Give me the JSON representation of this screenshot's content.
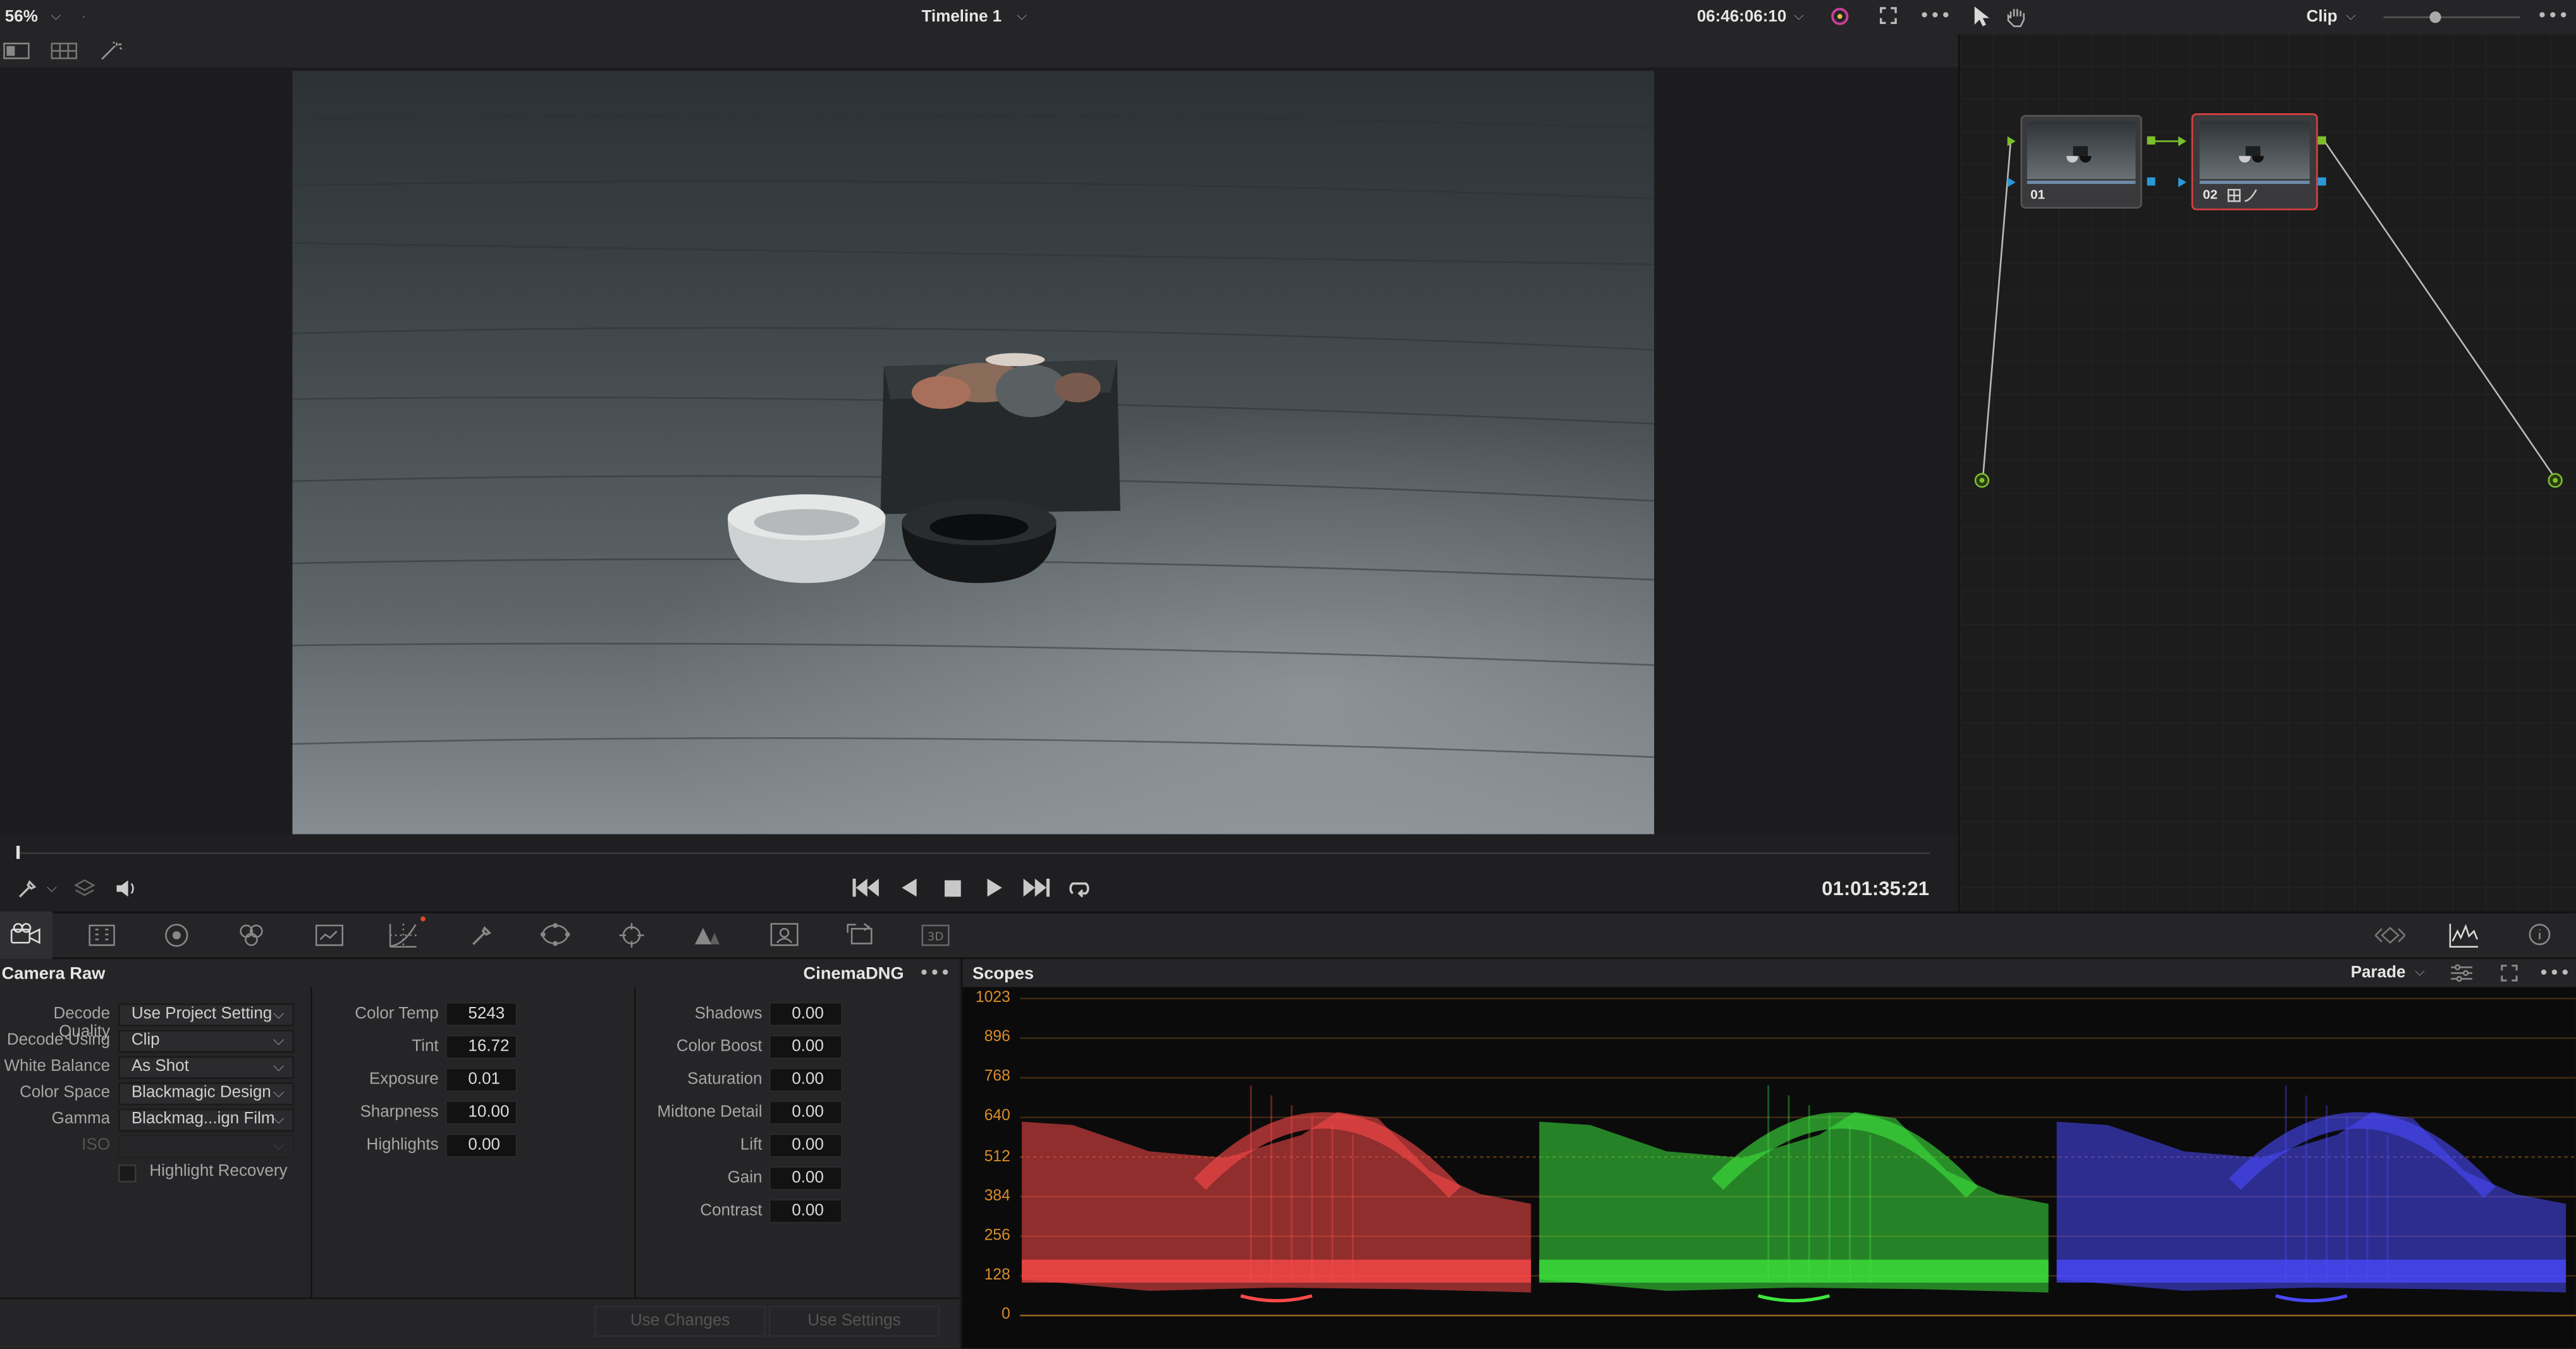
{
  "viewer": {
    "zoom": "56%",
    "timeline_title": "Timeline 1",
    "source_timecode": "06:46:06:10",
    "record_timecode": "01:01:35:21"
  },
  "node_editor": {
    "mode": "Clip",
    "nodes": [
      {
        "label": "01"
      },
      {
        "label": "02"
      }
    ]
  },
  "camera_raw": {
    "title": "Camera Raw",
    "format": "CinemaDNG",
    "decode_quality": {
      "label": "Decode Quality",
      "value": "Use Project Setting"
    },
    "decode_using": {
      "label": "Decode Using",
      "value": "Clip"
    },
    "white_balance": {
      "label": "White Balance",
      "value": "As Shot"
    },
    "color_space": {
      "label": "Color Space",
      "value": "Blackmagic Design"
    },
    "gamma": {
      "label": "Gamma",
      "value": "Blackmag...ign Film"
    },
    "iso": {
      "label": "ISO"
    },
    "highlight_recovery": "Highlight Recovery",
    "color_temp": {
      "label": "Color Temp",
      "value": "5243"
    },
    "tint": {
      "label": "Tint",
      "value": "16.72"
    },
    "exposure": {
      "label": "Exposure",
      "value": "0.01"
    },
    "sharpness": {
      "label": "Sharpness",
      "value": "10.00"
    },
    "highlights": {
      "label": "Highlights",
      "value": "0.00"
    },
    "shadows": {
      "label": "Shadows",
      "value": "0.00"
    },
    "color_boost": {
      "label": "Color Boost",
      "value": "0.00"
    },
    "saturation": {
      "label": "Saturation",
      "value": "0.00"
    },
    "midtone_detail": {
      "label": "Midtone Detail",
      "value": "0.00"
    },
    "lift": {
      "label": "Lift",
      "value": "0.00"
    },
    "gain": {
      "label": "Gain",
      "value": "0.00"
    },
    "contrast": {
      "label": "Contrast",
      "value": "0.00"
    },
    "use_changes": "Use Changes",
    "use_settings": "Use Settings"
  },
  "scopes": {
    "title": "Scopes",
    "mode": "Parade",
    "scale_labels": [
      "1023",
      "896",
      "768",
      "640",
      "512",
      "384",
      "256",
      "128",
      "0"
    ],
    "channel_colors": [
      "#ff4a4a",
      "#3ee63e",
      "#4a4aff"
    ],
    "grid_color": "#d98c2b"
  }
}
